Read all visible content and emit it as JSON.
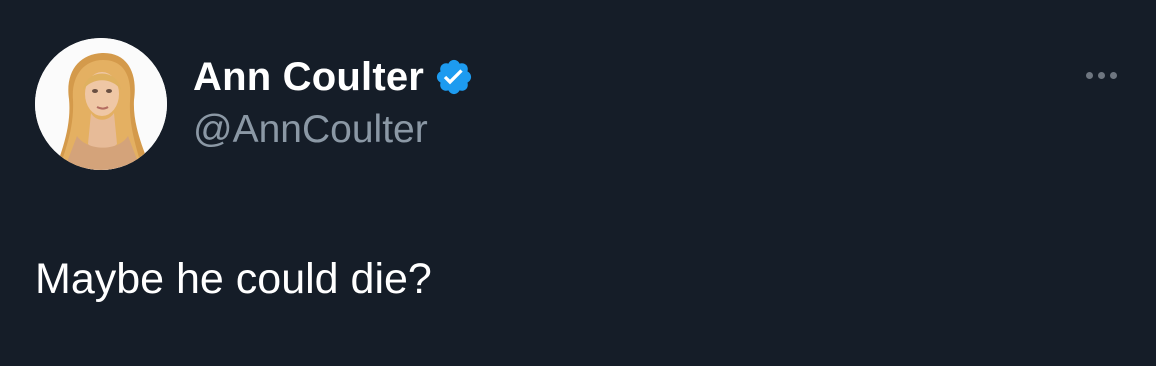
{
  "tweet": {
    "author": {
      "display_name": "Ann Coulter",
      "handle": "@AnnCoulter",
      "verified": true,
      "avatar_icon": "profile-photo",
      "verified_icon": "verified-badge-icon"
    },
    "text": "Maybe he could die?",
    "more_icon": "more-options-icon"
  },
  "colors": {
    "background": "#151d28",
    "text_primary": "#ffffff",
    "text_secondary": "#8b98a5",
    "verified_blue": "#1d9bf0",
    "more_dots": "#6e7680"
  }
}
